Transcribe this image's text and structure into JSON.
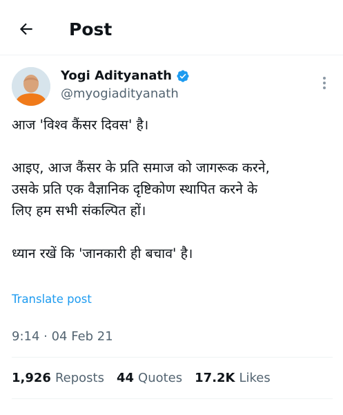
{
  "header": {
    "back_icon": "arrow-left-icon",
    "title": "Post"
  },
  "author": {
    "name": "Yogi Adityanath",
    "verified_icon": "verified-badge-icon",
    "verified_color": "#1d9bf0",
    "handle": "@myogiadityanath"
  },
  "post": {
    "paragraphs": [
      {
        "lines": [
          "आज 'विश्व कैंसर दिवस' है।"
        ]
      },
      {
        "lines": [
          "आइए, आज कैंसर के प्रति समाज को जागरूक करने,",
          "उसके प्रति एक वैज्ञानिक दृष्टिकोण स्थापित करने के",
          "लिए हम सभी संकल्पित हों।"
        ]
      },
      {
        "lines": [
          "ध्यान रखें कि 'जानकारी ही बचाव' है।"
        ]
      }
    ],
    "translate_label": "Translate post",
    "timestamp": "9:14 · 04 Feb 21"
  },
  "stats": {
    "reposts_count": "1,926",
    "reposts_label": "Reposts",
    "quotes_count": "44",
    "quotes_label": "Quotes",
    "likes_count": "17.2K",
    "likes_label": "Likes"
  },
  "colors": {
    "text_primary": "#0f1419",
    "text_secondary": "#536471",
    "link": "#1d9bf0",
    "divider": "#eff3f4"
  }
}
